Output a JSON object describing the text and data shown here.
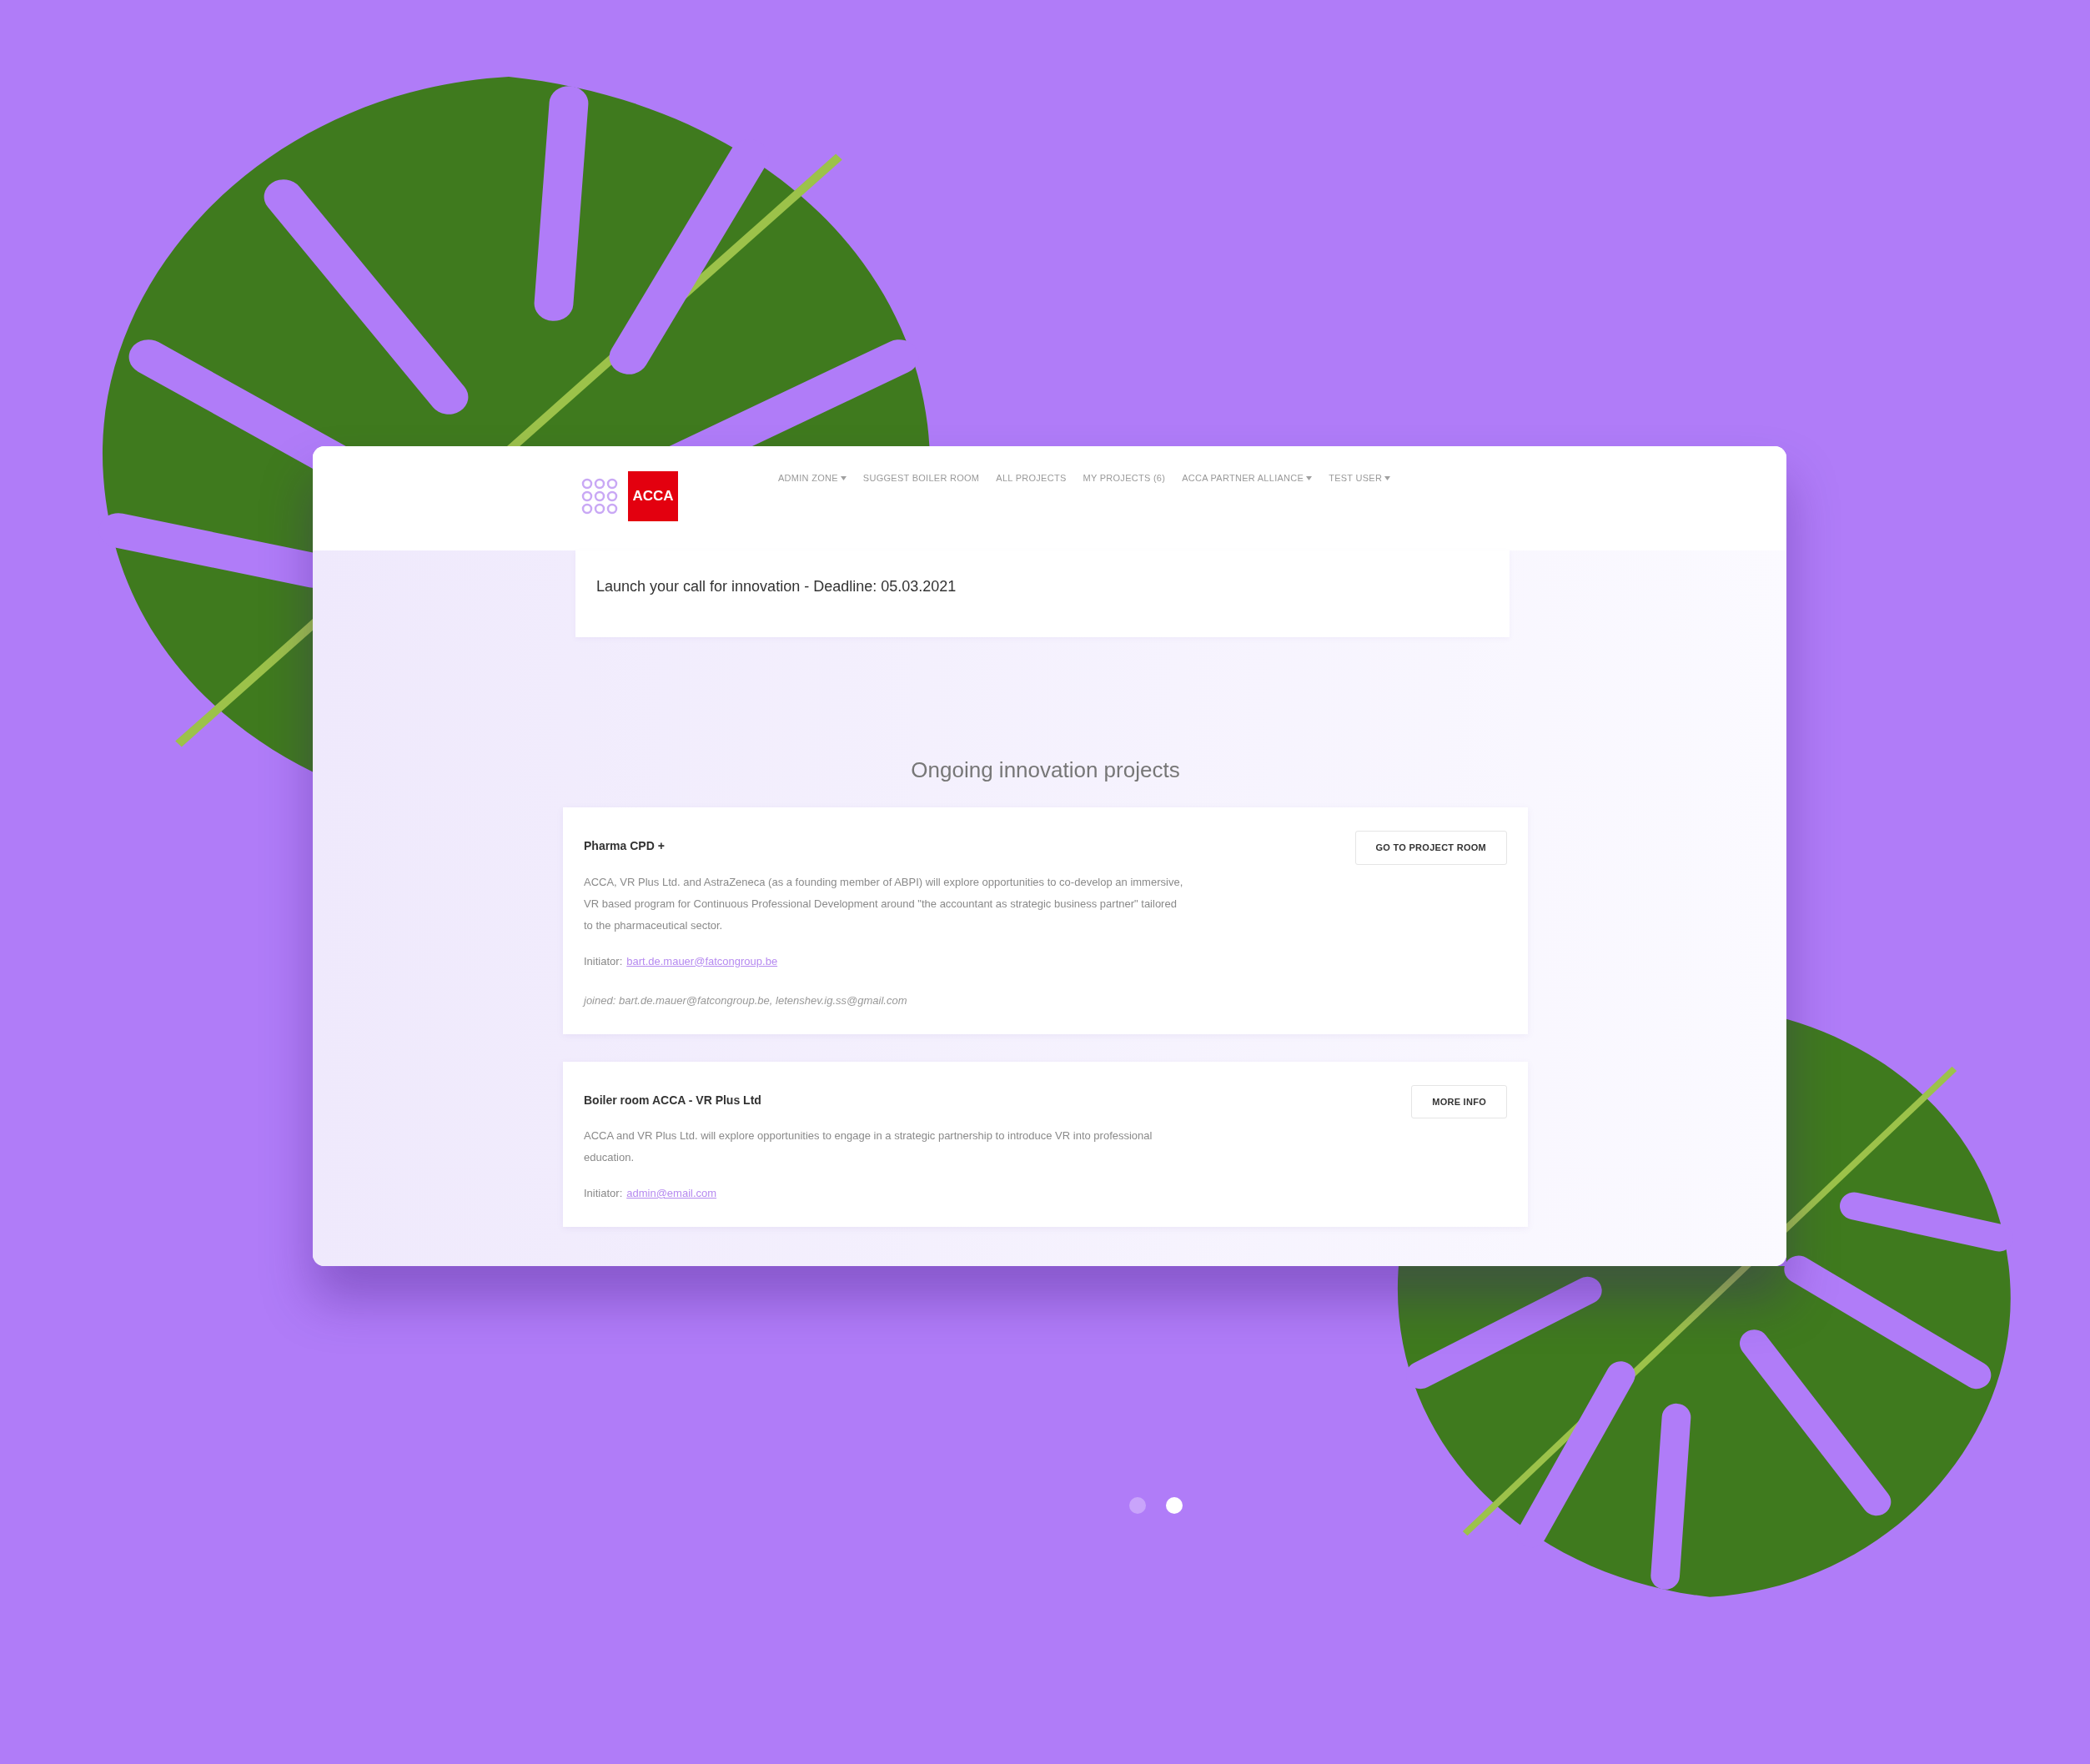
{
  "header": {
    "logo": "ACCA",
    "nav": [
      {
        "label": "ADMIN ZONE",
        "dropdown": true
      },
      {
        "label": "SUGGEST BOILER ROOM",
        "dropdown": false
      },
      {
        "label": "ALL PROJECTS",
        "dropdown": false
      },
      {
        "label": "MY PROJECTS (6)",
        "dropdown": false
      },
      {
        "label": "ACCA PARTNER ALLIANCE",
        "dropdown": true
      },
      {
        "label": "TEST USER",
        "dropdown": true
      }
    ]
  },
  "banner": {
    "text": "Launch your call for innovation - Deadline: 05.03.2021"
  },
  "section_title": "Ongoing innovation projects",
  "projects": [
    {
      "title": "Pharma CPD +",
      "button": "GO TO PROJECT ROOM",
      "description": "ACCA, VR Plus Ltd. and AstraZeneca (as a founding member of ABPI) will explore opportunities to co-develop an immersive, VR based program for Continuous Professional Development around \"the accountant as strategic business partner\" tailored to the pharmaceutical sector.",
      "initiator_label": "Initiator:",
      "initiator": "bart.de.mauer@fatcongroup.be",
      "joined": "joined: bart.de.mauer@fatcongroup.be, letenshev.ig.ss@gmail.com"
    },
    {
      "title": "Boiler room ACCA - VR Plus Ltd",
      "button": "MORE INFO",
      "description": "ACCA and VR Plus Ltd. will explore opportunities to engage in a strategic partnership to introduce VR into professional education.",
      "initiator_label": "Initiator:",
      "initiator": "admin@email.com"
    }
  ],
  "carousel": [
    {
      "selected": false
    },
    {
      "selected": true
    }
  ]
}
